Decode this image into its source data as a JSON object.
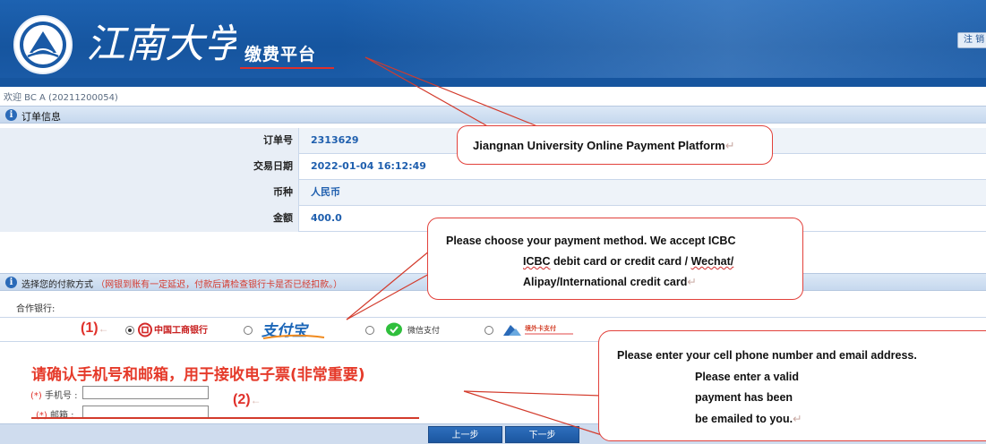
{
  "header": {
    "logo_text": "江南大学",
    "platform_title": "缴费平台",
    "logout_label": "注 销"
  },
  "welcome": "欢迎 BC A (20211200054)",
  "order_section": {
    "title": "订单信息",
    "rows": [
      {
        "label": "订单号",
        "value": "2313629"
      },
      {
        "label": "交易日期",
        "value": "2022-01-04 16:12:49"
      },
      {
        "label": "币种",
        "value": "人民币"
      },
      {
        "label": "金额",
        "value": "400.0"
      }
    ]
  },
  "payment_section": {
    "title": "选择您的付款方式",
    "warning": "（网银到账有一定延迟，付款后请检查银行卡是否已经扣款。）",
    "partner_label": "合作银行:",
    "methods": [
      {
        "label": "中国工商银行",
        "selected": true
      },
      {
        "label": "支付宝",
        "selected": false
      },
      {
        "label": "微信支付",
        "selected": false
      },
      {
        "label": "境外卡支付",
        "selected": false
      }
    ]
  },
  "contact": {
    "notice": "请确认手机号和邮箱，用于接收电子票(非常重要)",
    "required_mark": "(*)",
    "phone_label": "手机号 :",
    "email_label": "邮箱 :",
    "phone_value": "",
    "email_value": ""
  },
  "nav": {
    "prev_label": "上一步",
    "next_label": "下一步"
  },
  "annotations": {
    "title_callout": "Jiangnan University Online Payment Platform",
    "payment_callout": {
      "line1": "Please choose your payment method. We accept ICBC",
      "line2_a": "ICBC",
      "line2_b": " debit card or credit card / ",
      "line2_c": "Wechat/",
      "line3": "Alipay/International credit card"
    },
    "contact_callout": {
      "line1": "Please enter your cell phone number and email address.",
      "line2": "Please enter a valid",
      "line3": "payment has been",
      "line4": "be emailed to you."
    },
    "marker1": "(1)",
    "marker2": "(2)",
    "arrow_glyph": "←",
    "return_glyph": "↵"
  },
  "colors": {
    "header_blue": "#16559f",
    "accent_red": "#e0302a",
    "value_blue": "#1f5fae"
  }
}
